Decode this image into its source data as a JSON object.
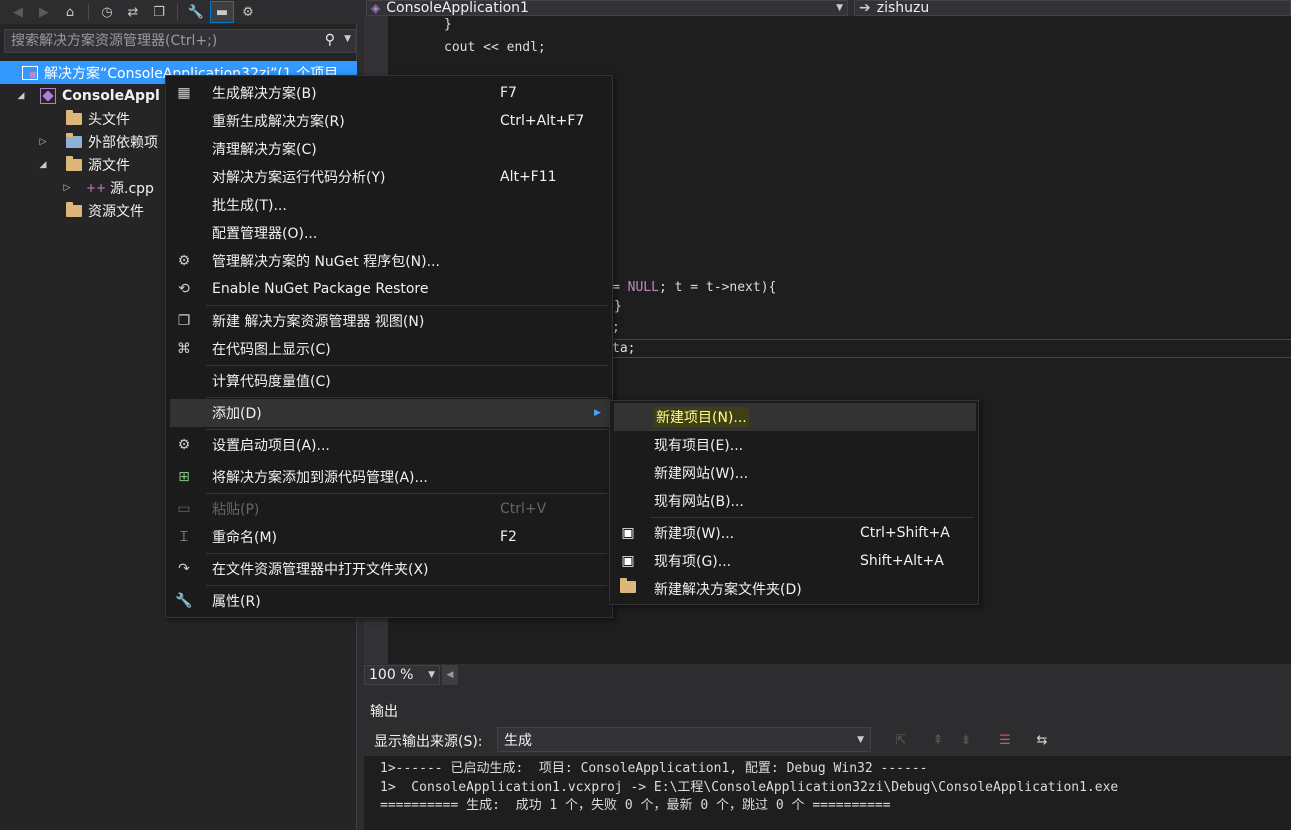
{
  "solution_explorer": {
    "toolbar": {
      "icons": [
        "back-icon",
        "forward-icon",
        "home-icon",
        "history-icon",
        "sync-icon",
        "collapse-icon",
        "properties-icon",
        "preview-icon",
        "class-diagram-icon"
      ]
    },
    "search_placeholder": "搜索解决方案资源管理器(Ctrl+;)",
    "tree": [
      {
        "label": "解决方案“ConsoleApplication32zi”(1 个项目",
        "selected": true
      },
      {
        "label": "ConsoleAppl",
        "bold": true
      },
      {
        "label": "头文件"
      },
      {
        "label": "外部依赖项"
      },
      {
        "label": "源文件"
      },
      {
        "label": "源.cpp"
      },
      {
        "label": "资源文件"
      }
    ]
  },
  "editor": {
    "project_combo": "ConsoleApplication1",
    "scope_combo": "zishuzu",
    "code_lines": [
      {
        "text": "}"
      },
      {
        "text": "cout << endl;"
      },
      {
        "pre": "= ",
        "kw": "NULL",
        "post": "; t = t->next){"
      },
      {
        "text": "}"
      },
      {
        "text": ";"
      },
      {
        "text": "ta;"
      }
    ],
    "zoom": "100 %"
  },
  "output": {
    "title": "输出",
    "source_label": "显示输出来源(S):",
    "source_value": "生成",
    "lines": [
      "1>------ 已启动生成:  项目: ConsoleApplication1, 配置: Debug Win32 ------",
      "1>  ConsoleApplication1.vcxproj -> E:\\工程\\ConsoleApplication32zi\\Debug\\ConsoleApplication1.exe",
      "========== 生成:  成功 1 个，失败 0 个，最新 0 个，跳过 0 个 =========="
    ]
  },
  "context_menu": {
    "items": [
      {
        "label": "生成解决方案(B)",
        "shortcut": "F7",
        "icon": "build-icon"
      },
      {
        "label": "重新生成解决方案(R)",
        "shortcut": "Ctrl+Alt+F7"
      },
      {
        "label": "清理解决方案(C)"
      },
      {
        "label": "对解决方案运行代码分析(Y)",
        "shortcut": "Alt+F11"
      },
      {
        "label": "批生成(T)..."
      },
      {
        "label": "配置管理器(O)..."
      },
      {
        "label": "管理解决方案的 NuGet 程序包(N)...",
        "icon": "nuget-icon"
      },
      {
        "label": "Enable NuGet Package Restore",
        "icon": "package-restore-icon"
      },
      {
        "label": "新建 解决方案资源管理器 视图(N)",
        "icon": "new-view-icon"
      },
      {
        "label": "在代码图上显示(C)",
        "icon": "code-map-icon"
      },
      {
        "label": "计算代码度量值(C)"
      },
      {
        "label": "添加(D)",
        "submenu": true
      },
      {
        "label": "设置启动项目(A)...",
        "icon": "gear-icon"
      },
      {
        "label": "将解决方案添加到源代码管理(A)...",
        "icon": "source-control-icon"
      },
      {
        "label": "粘贴(P)",
        "shortcut": "Ctrl+V",
        "disabled": true,
        "icon": "paste-icon"
      },
      {
        "label": "重命名(M)",
        "shortcut": "F2",
        "icon": "rename-icon"
      },
      {
        "label": "在文件资源管理器中打开文件夹(X)",
        "icon": "open-folder-icon"
      },
      {
        "label": "属性(R)",
        "icon": "wrench-icon"
      }
    ]
  },
  "add_submenu": {
    "items": [
      {
        "label": "新建项目(N)...",
        "highlighted": true
      },
      {
        "label": "现有项目(E)..."
      },
      {
        "label": "新建网站(W)..."
      },
      {
        "label": "现有网站(B)..."
      },
      {
        "label": "新建项(W)...",
        "shortcut": "Ctrl+Shift+A",
        "icon": "new-item-icon"
      },
      {
        "label": "现有项(G)...",
        "shortcut": "Shift+Alt+A",
        "icon": "existing-item-icon"
      },
      {
        "label": "新建解决方案文件夹(D)",
        "icon": "solution-folder-icon"
      }
    ]
  }
}
